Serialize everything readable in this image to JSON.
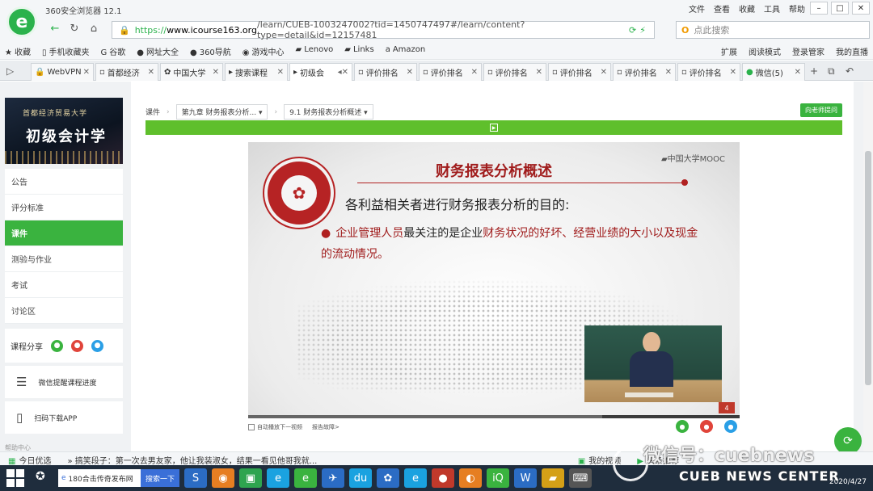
{
  "browser": {
    "title": "360安全浏览器 12.1",
    "menus": [
      "文件",
      "查看",
      "收藏",
      "工具",
      "帮助"
    ],
    "url_proto": "https://",
    "url_host": "www.icourse163.org",
    "url_path": "/learn/CUEB-1003247002?tid=1450747497#/learn/content?type=detail&id=12157481",
    "search_placeholder": "点此搜索"
  },
  "bookmarks": {
    "items": [
      "收藏",
      "手机收藏夹",
      "谷歌",
      "网址大全",
      "360导航",
      "游戏中心",
      "Lenovo",
      "Links",
      "Amazon"
    ],
    "right": [
      "扩展",
      "阅读模式",
      "登录管家",
      "我的直播"
    ]
  },
  "tabs": [
    {
      "label": "WebVPN"
    },
    {
      "label": "首都经济"
    },
    {
      "label": "中国大学"
    },
    {
      "label": "搜索课程"
    },
    {
      "label": "初级会"
    },
    {
      "label": "评价排名"
    },
    {
      "label": "评价排名"
    },
    {
      "label": "评价排名"
    },
    {
      "label": "评价排名"
    },
    {
      "label": "评价排名"
    },
    {
      "label": "评价排名"
    },
    {
      "label": "微信(5)"
    }
  ],
  "sidebar": {
    "school": "首都经济贸易大学",
    "course_name": "初级会计学",
    "items": [
      "公告",
      "评分标准",
      "课件",
      "测验与作业",
      "考试",
      "讨论区"
    ],
    "active_index": 2,
    "share_label": "课程分享",
    "tools": [
      "微信提醒课程进度",
      "扫码下载APP"
    ],
    "help": "帮助中心"
  },
  "main": {
    "crumb_root": "课件",
    "chapter": "第九章 财务报表分析...",
    "section": "9.1 财务报表分析概述",
    "ask_button": "向老师提问"
  },
  "slide": {
    "title": "财务报表分析概述",
    "brand": "中国大学MOOC",
    "subtitle": "各利益相关者进行财务报表分析的目的:",
    "bullet_1": "企业管理人员",
    "bullet_2": "最关注的是",
    "bullet_3": "企业",
    "bullet_4": "财务状况的好坏、经营业绩的大小以及现金的流动情况。",
    "page": "4",
    "progress": 0.72
  },
  "below_video": {
    "autoplay": "自动播放下一视频",
    "report": "报告故障>"
  },
  "statusbar": {
    "left": [
      "今日优选",
      "搞笑段子：第一次去男友家，他让我装淑女，结果一看见他哥我就..."
    ],
    "right": [
      "我的视频",
      "头条推荐"
    ]
  },
  "taskbar": {
    "search_text": "180合击传奇发布网",
    "search_button": "搜索一下",
    "date": "2020/4/27"
  },
  "watermark": {
    "line1": "微信号：cuebnews",
    "line2": "CUEB NEWS CENTER"
  }
}
